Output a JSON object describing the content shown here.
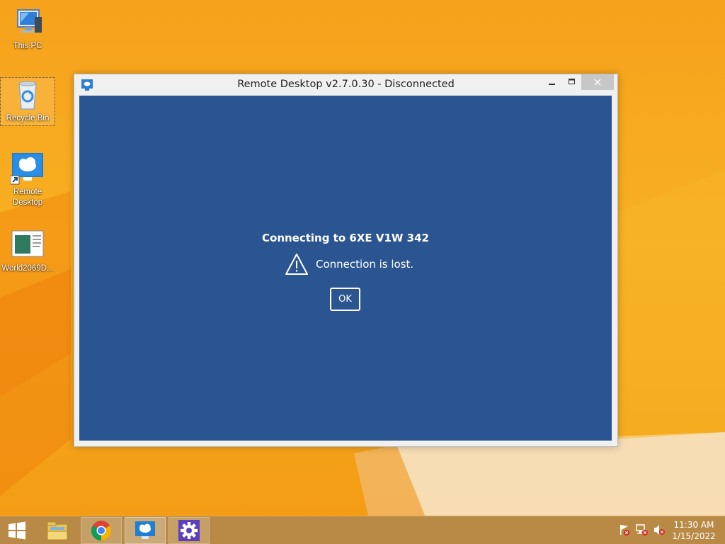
{
  "desktop": {
    "icons": [
      {
        "label": "This PC",
        "icon": "computer-icon"
      },
      {
        "label": "Recycle Bin",
        "icon": "recycle-bin-icon"
      },
      {
        "label": "Remote Desktop",
        "icon": "remote-desktop-icon"
      },
      {
        "label": "World2069D...",
        "icon": "document-icon"
      }
    ]
  },
  "window": {
    "title": "Remote Desktop v2.7.0.30 - Disconnected",
    "controls": {
      "minimize": "–",
      "maximize": "□",
      "close": "✕"
    },
    "dialog": {
      "heading": "Connecting to 6XE V1W 342",
      "message": "Connection is lost.",
      "ok_label": "OK"
    },
    "colors": {
      "content_bg": "#2a5591"
    }
  },
  "taskbar": {
    "items": [
      "start-button",
      "file-explorer",
      "chrome",
      "remote-desktop",
      "settings"
    ],
    "tray_icons": [
      "action-center-flag-icon",
      "network-icon",
      "volume-muted-icon"
    ],
    "clock": {
      "time": "11:30 AM",
      "date": "1/15/2022"
    }
  }
}
